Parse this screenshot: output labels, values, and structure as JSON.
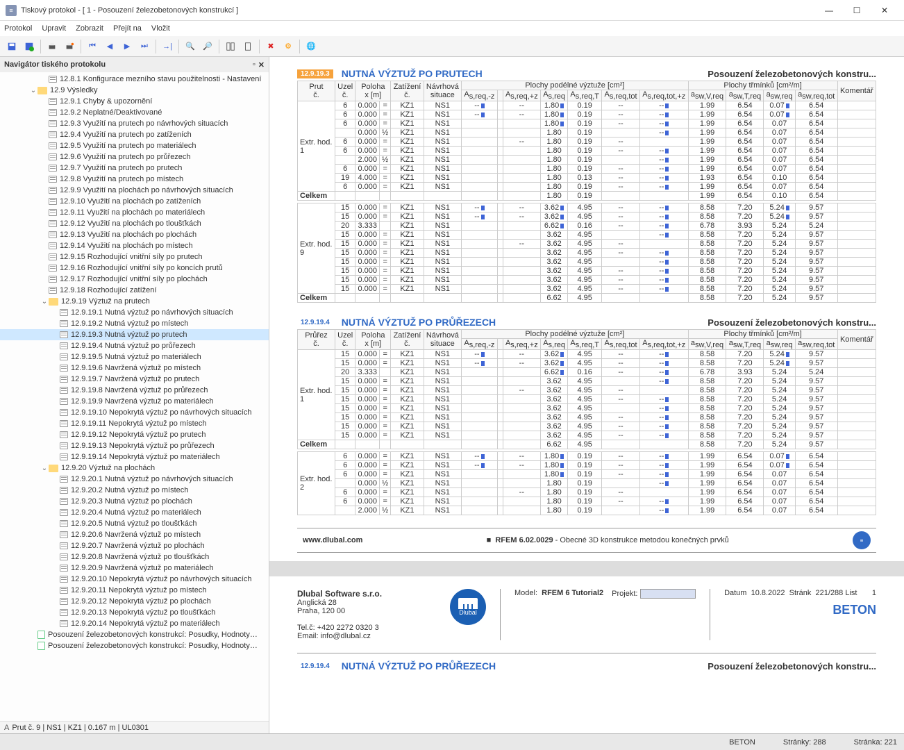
{
  "title": "Tiskový protokol - [ 1 - Posouzení železobetonových konstrukcí ]",
  "menu": [
    "Protokol",
    "Upravit",
    "Zobrazit",
    "Přejít na",
    "Vložit"
  ],
  "navHeader": "Navigátor tiského protokolu",
  "tree": [
    {
      "d": 3,
      "i": "grid",
      "t": "12.8.1 Konfigurace mezního stavu použitelnosti - Nastavení"
    },
    {
      "d": 2,
      "i": "folder",
      "t": "12.9 Výsledky",
      "tw": "v"
    },
    {
      "d": 3,
      "i": "grid",
      "t": "12.9.1 Chyby & upozornění"
    },
    {
      "d": 3,
      "i": "grid",
      "t": "12.9.2 Neplatné/Deaktivované"
    },
    {
      "d": 3,
      "i": "grid",
      "t": "12.9.3 Využití na prutech po návrhových situacích"
    },
    {
      "d": 3,
      "i": "grid",
      "t": "12.9.4 Využití na prutech po zatíženích"
    },
    {
      "d": 3,
      "i": "grid",
      "t": "12.9.5 Využití na prutech po materiálech"
    },
    {
      "d": 3,
      "i": "grid",
      "t": "12.9.6 Využití na prutech po průřezech"
    },
    {
      "d": 3,
      "i": "grid",
      "t": "12.9.7 Využití na prutech po prutech"
    },
    {
      "d": 3,
      "i": "grid",
      "t": "12.9.8 Využití na prutech po místech"
    },
    {
      "d": 3,
      "i": "grid",
      "t": "12.9.9 Využití na plochách po návrhových situacích"
    },
    {
      "d": 3,
      "i": "grid",
      "t": "12.9.10 Využití na plochách po zatíženích"
    },
    {
      "d": 3,
      "i": "grid",
      "t": "12.9.11 Využití na plochách po materiálech"
    },
    {
      "d": 3,
      "i": "grid",
      "t": "12.9.12 Využití na plochách po tloušťkách"
    },
    {
      "d": 3,
      "i": "grid",
      "t": "12.9.13 Využití na plochách po plochách"
    },
    {
      "d": 3,
      "i": "grid",
      "t": "12.9.14 Využití na plochách po místech"
    },
    {
      "d": 3,
      "i": "grid",
      "t": "12.9.15 Rozhodující vnitřní síly po prutech"
    },
    {
      "d": 3,
      "i": "grid",
      "t": "12.9.16 Rozhodující vnitřní síly po koncích prutů"
    },
    {
      "d": 3,
      "i": "grid",
      "t": "12.9.17 Rozhodující vnitřní síly po plochách"
    },
    {
      "d": 3,
      "i": "grid",
      "t": "12.9.18 Rozhodující zatížení"
    },
    {
      "d": 3,
      "i": "folder",
      "t": "12.9.19 Výztuž na prutech",
      "tw": "v"
    },
    {
      "d": 4,
      "i": "grid",
      "t": "12.9.19.1 Nutná výztuž po návrhových situacích"
    },
    {
      "d": 4,
      "i": "grid",
      "t": "12.9.19.2 Nutná výztuž po místech"
    },
    {
      "d": 4,
      "i": "grid",
      "t": "12.9.19.3 Nutná výztuž po prutech",
      "sel": true
    },
    {
      "d": 4,
      "i": "grid",
      "t": "12.9.19.4 Nutná výztuž po průřezech"
    },
    {
      "d": 4,
      "i": "grid",
      "t": "12.9.19.5 Nutná výztuž po materiálech"
    },
    {
      "d": 4,
      "i": "grid",
      "t": "12.9.19.6 Navržená výztuž po místech"
    },
    {
      "d": 4,
      "i": "grid",
      "t": "12.9.19.7 Navržená výztuž po prutech"
    },
    {
      "d": 4,
      "i": "grid",
      "t": "12.9.19.8 Navržená výztuž po průřezech"
    },
    {
      "d": 4,
      "i": "grid",
      "t": "12.9.19.9 Navržená výztuž po materiálech"
    },
    {
      "d": 4,
      "i": "grid",
      "t": "12.9.19.10 Nepokrytá výztuž po návrhových situacích"
    },
    {
      "d": 4,
      "i": "grid",
      "t": "12.9.19.11 Nepokrytá výztuž po místech"
    },
    {
      "d": 4,
      "i": "grid",
      "t": "12.9.19.12 Nepokrytá výztuž po prutech"
    },
    {
      "d": 4,
      "i": "grid",
      "t": "12.9.19.13 Nepokrytá výztuž po průřezech"
    },
    {
      "d": 4,
      "i": "grid",
      "t": "12.9.19.14 Nepokrytá výztuž po materiálech"
    },
    {
      "d": 3,
      "i": "folder",
      "t": "12.9.20 Výztuž na plochách",
      "tw": "v"
    },
    {
      "d": 4,
      "i": "grid",
      "t": "12.9.20.1 Nutná výztuž po návrhových situacích"
    },
    {
      "d": 4,
      "i": "grid",
      "t": "12.9.20.2 Nutná výztuž po místech"
    },
    {
      "d": 4,
      "i": "grid",
      "t": "12.9.20.3 Nutná výztuž po plochách"
    },
    {
      "d": 4,
      "i": "grid",
      "t": "12.9.20.4 Nutná výztuž po materiálech"
    },
    {
      "d": 4,
      "i": "grid",
      "t": "12.9.20.5 Nutná výztuž po tloušťkách"
    },
    {
      "d": 4,
      "i": "grid",
      "t": "12.9.20.6 Navržená výztuž po místech"
    },
    {
      "d": 4,
      "i": "grid",
      "t": "12.9.20.7 Navržená výztuž po plochách"
    },
    {
      "d": 4,
      "i": "grid",
      "t": "12.9.20.8 Navržená výztuž po tloušťkách"
    },
    {
      "d": 4,
      "i": "grid",
      "t": "12.9.20.9 Navržená výztuž po materiálech"
    },
    {
      "d": 4,
      "i": "grid",
      "t": "12.9.20.10 Nepokrytá výztuž po návrhových situacích"
    },
    {
      "d": 4,
      "i": "grid",
      "t": "12.9.20.11 Nepokrytá výztuž po místech"
    },
    {
      "d": 4,
      "i": "grid",
      "t": "12.9.20.12 Nepokrytá výztuž po plochách"
    },
    {
      "d": 4,
      "i": "grid",
      "t": "12.9.20.13 Nepokrytá výztuž po tloušťkách"
    },
    {
      "d": 4,
      "i": "grid",
      "t": "12.9.20.14 Nepokrytá výztuž po materiálech"
    },
    {
      "d": 2,
      "i": "doc",
      "t": "Posouzení železobetonových konstrukcí: Posudky, Hodnoty…"
    },
    {
      "d": 2,
      "i": "doc",
      "t": "Posouzení železobetonových konstrukcí: Posudky, Hodnoty…"
    }
  ],
  "statusLocal": "Prut č. 9 | NS1 | KZ1 | 0.167 m | UL0301",
  "sections": [
    {
      "tag": "12.9.19.3",
      "tagcls": "tag",
      "title": "NUTNÁ VÝZTUŽ PO PRUTECH",
      "right": "Posouzení železobetonových konstru...",
      "colA": "Prut",
      "exLabel": "Extr. hod.",
      "exNo": "1",
      "rows": [
        [
          "6",
          "0.000",
          "=",
          "KZ1",
          "NS1",
          "--",
          "",
          "--",
          "1.80",
          "0.19",
          "--",
          "--",
          "1.99",
          "6.54",
          "0.07",
          "6.54"
        ],
        [
          "6",
          "0.000",
          "=",
          "KZ1",
          "NS1",
          "--",
          "",
          "--",
          "1.80",
          "0.19",
          "--",
          "--",
          "1.99",
          "6.54",
          "0.07",
          "6.54"
        ],
        [
          "6",
          "0.000",
          "=",
          "KZ1",
          "NS1",
          "",
          "",
          "",
          "1.80",
          "0.19",
          "--",
          "--",
          "1.99",
          "6.54",
          "0.07",
          "6.54"
        ],
        [
          "",
          "0.000",
          "½",
          "KZ1",
          "NS1",
          "",
          "",
          "",
          "1.80",
          "0.19",
          "",
          "--",
          "1.99",
          "6.54",
          "0.07",
          "6.54"
        ],
        [
          "6",
          "0.000",
          "=",
          "KZ1",
          "NS1",
          "",
          "",
          "--",
          "1.80",
          "0.19",
          "--",
          "",
          "1.99",
          "6.54",
          "0.07",
          "6.54"
        ],
        [
          "6",
          "0.000",
          "=",
          "KZ1",
          "NS1",
          "",
          "",
          "",
          "1.80",
          "0.19",
          "--",
          "--",
          "1.99",
          "6.54",
          "0.07",
          "6.54"
        ],
        [
          "",
          "2.000",
          "½",
          "KZ1",
          "NS1",
          "",
          "",
          "",
          "1.80",
          "0.19",
          "",
          "--",
          "1.99",
          "6.54",
          "0.07",
          "6.54"
        ],
        [
          "6",
          "0.000",
          "=",
          "KZ1",
          "NS1",
          "",
          "",
          "",
          "1.80",
          "0.19",
          "--",
          "--",
          "1.99",
          "6.54",
          "0.07",
          "6.54"
        ],
        [
          "19",
          "4.000",
          "=",
          "KZ1",
          "NS1",
          "",
          "",
          "",
          "1.80",
          "0.13",
          "--",
          "--",
          "1.93",
          "6.54",
          "0.10",
          "6.54"
        ],
        [
          "6",
          "0.000",
          "=",
          "KZ1",
          "NS1",
          "",
          "",
          "",
          "1.80",
          "0.19",
          "--",
          "--",
          "1.99",
          "6.54",
          "0.07",
          "6.54"
        ]
      ],
      "total": [
        "Celkem",
        "",
        "",
        "",
        "",
        "",
        "",
        "",
        "1.80",
        "0.19",
        "",
        "",
        "1.99",
        "6.54",
        "0.10",
        "6.54"
      ],
      "ex2Label": "Extr. hod.",
      "ex2No": "9",
      "rows2": [
        [
          "15",
          "0.000",
          "=",
          "KZ1",
          "NS1",
          "--",
          "",
          "--",
          "3.62",
          "4.95",
          "--",
          "--",
          "8.58",
          "7.20",
          "5.24",
          "9.57"
        ],
        [
          "15",
          "0.000",
          "=",
          "KZ1",
          "NS1",
          "--",
          "",
          "--",
          "3.62",
          "4.95",
          "--",
          "--",
          "8.58",
          "7.20",
          "5.24",
          "9.57"
        ],
        [
          "20",
          "3.333",
          "",
          "KZ1",
          "NS1",
          "",
          "",
          "",
          "6.62",
          "0.16",
          "--",
          "--",
          "6.78",
          "3.93",
          "5.24",
          "5.24"
        ],
        [
          "15",
          "0.000",
          "=",
          "KZ1",
          "NS1",
          "",
          "",
          "",
          "3.62",
          "4.95",
          "",
          "--",
          "8.58",
          "7.20",
          "5.24",
          "9.57"
        ],
        [
          "15",
          "0.000",
          "=",
          "KZ1",
          "NS1",
          "",
          "",
          "--",
          "3.62",
          "4.95",
          "--",
          "",
          "8.58",
          "7.20",
          "5.24",
          "9.57"
        ],
        [
          "15",
          "0.000",
          "=",
          "KZ1",
          "NS1",
          "",
          "",
          "",
          "3.62",
          "4.95",
          "--",
          "--",
          "8.58",
          "7.20",
          "5.24",
          "9.57"
        ],
        [
          "15",
          "0.000",
          "=",
          "KZ1",
          "NS1",
          "",
          "",
          "",
          "3.62",
          "4.95",
          "",
          "--",
          "8.58",
          "7.20",
          "5.24",
          "9.57"
        ],
        [
          "15",
          "0.000",
          "=",
          "KZ1",
          "NS1",
          "",
          "",
          "",
          "3.62",
          "4.95",
          "--",
          "--",
          "8.58",
          "7.20",
          "5.24",
          "9.57"
        ],
        [
          "15",
          "0.000",
          "=",
          "KZ1",
          "NS1",
          "",
          "",
          "",
          "3.62",
          "4.95",
          "--",
          "--",
          "8.58",
          "7.20",
          "5.24",
          "9.57"
        ],
        [
          "15",
          "0.000",
          "=",
          "KZ1",
          "NS1",
          "",
          "",
          "",
          "3.62",
          "4.95",
          "--",
          "--",
          "8.58",
          "7.20",
          "5.24",
          "9.57"
        ]
      ],
      "total2": [
        "Celkem",
        "",
        "",
        "",
        "",
        "",
        "",
        "",
        "6.62",
        "4.95",
        "",
        "",
        "8.58",
        "7.20",
        "5.24",
        "9.57"
      ]
    },
    {
      "tag": "12.9.19.4",
      "tagcls": "tagb",
      "title": "NUTNÁ VÝZTUŽ PO PRŮŘEZECH",
      "right": "Posouzení železobetonových konstru...",
      "colA": "Průřez",
      "exLabel": "Extr. hod.",
      "exNo": "1",
      "rows": [
        [
          "15",
          "0.000",
          "=",
          "KZ1",
          "NS1",
          "--",
          "",
          "--",
          "3.62",
          "4.95",
          "--",
          "--",
          "8.58",
          "7.20",
          "5.24",
          "9.57"
        ],
        [
          "15",
          "0.000",
          "=",
          "KZ1",
          "NS1",
          "--",
          "",
          "--",
          "3.62",
          "4.95",
          "--",
          "--",
          "8.58",
          "7.20",
          "5.24",
          "9.57"
        ],
        [
          "20",
          "3.333",
          "",
          "KZ1",
          "NS1",
          "",
          "",
          "",
          "6.62",
          "0.16",
          "--",
          "--",
          "6.78",
          "3.93",
          "5.24",
          "5.24"
        ],
        [
          "15",
          "0.000",
          "=",
          "KZ1",
          "NS1",
          "",
          "",
          "",
          "3.62",
          "4.95",
          "",
          "--",
          "8.58",
          "7.20",
          "5.24",
          "9.57"
        ],
        [
          "15",
          "0.000",
          "=",
          "KZ1",
          "NS1",
          "",
          "",
          "--",
          "3.62",
          "4.95",
          "--",
          "",
          "8.58",
          "7.20",
          "5.24",
          "9.57"
        ],
        [
          "15",
          "0.000",
          "=",
          "KZ1",
          "NS1",
          "",
          "",
          "",
          "3.62",
          "4.95",
          "--",
          "--",
          "8.58",
          "7.20",
          "5.24",
          "9.57"
        ],
        [
          "15",
          "0.000",
          "=",
          "KZ1",
          "NS1",
          "",
          "",
          "",
          "3.62",
          "4.95",
          "",
          "--",
          "8.58",
          "7.20",
          "5.24",
          "9.57"
        ],
        [
          "15",
          "0.000",
          "=",
          "KZ1",
          "NS1",
          "",
          "",
          "",
          "3.62",
          "4.95",
          "--",
          "--",
          "8.58",
          "7.20",
          "5.24",
          "9.57"
        ],
        [
          "15",
          "0.000",
          "=",
          "KZ1",
          "NS1",
          "",
          "",
          "",
          "3.62",
          "4.95",
          "--",
          "--",
          "8.58",
          "7.20",
          "5.24",
          "9.57"
        ],
        [
          "15",
          "0.000",
          "=",
          "KZ1",
          "NS1",
          "",
          "",
          "",
          "3.62",
          "4.95",
          "--",
          "--",
          "8.58",
          "7.20",
          "5.24",
          "9.57"
        ]
      ],
      "total": [
        "Celkem",
        "",
        "",
        "",
        "",
        "",
        "",
        "",
        "6.62",
        "4.95",
        "",
        "",
        "8.58",
        "7.20",
        "5.24",
        "9.57"
      ],
      "ex2Label": "Extr. hod.",
      "ex2No": "2",
      "rows2": [
        [
          "6",
          "0.000",
          "=",
          "KZ1",
          "NS1",
          "--",
          "",
          "--",
          "1.80",
          "0.19",
          "--",
          "--",
          "1.99",
          "6.54",
          "0.07",
          "6.54"
        ],
        [
          "6",
          "0.000",
          "=",
          "KZ1",
          "NS1",
          "--",
          "",
          "--",
          "1.80",
          "0.19",
          "--",
          "--",
          "1.99",
          "6.54",
          "0.07",
          "6.54"
        ],
        [
          "6",
          "0.000",
          "=",
          "KZ1",
          "NS1",
          "",
          "",
          "",
          "1.80",
          "0.19",
          "--",
          "--",
          "1.99",
          "6.54",
          "0.07",
          "6.54"
        ],
        [
          "",
          "0.000",
          "½",
          "KZ1",
          "NS1",
          "",
          "",
          "",
          "1.80",
          "0.19",
          "",
          "--",
          "1.99",
          "6.54",
          "0.07",
          "6.54"
        ],
        [
          "6",
          "0.000",
          "=",
          "KZ1",
          "NS1",
          "",
          "",
          "--",
          "1.80",
          "0.19",
          "--",
          "",
          "1.99",
          "6.54",
          "0.07",
          "6.54"
        ],
        [
          "6",
          "0.000",
          "=",
          "KZ1",
          "NS1",
          "",
          "",
          "",
          "1.80",
          "0.19",
          "--",
          "--",
          "1.99",
          "6.54",
          "0.07",
          "6.54"
        ],
        [
          "",
          "2.000",
          "½",
          "KZ1",
          "NS1",
          "",
          "",
          "",
          "1.80",
          "0.19",
          "",
          "--",
          "1.99",
          "6.54",
          "0.07",
          "6.54"
        ]
      ]
    }
  ],
  "pageFooter": {
    "url": "www.dlubal.com",
    "app": "RFEM 6.02.0029",
    "desc": "Obecné 3D konstrukce metodou konečných prvků"
  },
  "company": {
    "name": "Dlubal Software s.r.o.",
    "l1": "Anglická 28",
    "l2": "Praha, 120 00",
    "tel": "Tel.č: +420 2272 0320 3",
    "mail": "Email: info@dlubal.cz"
  },
  "pmeta": {
    "model": "Model:",
    "modelv": "RFEM 6 Tutorial2",
    "proj": "Projekt:",
    "date": "Datum",
    "datev": "10.8.2022",
    "page": "Stránk",
    "pagev": "221/288",
    "list": "List",
    "listv": "1"
  },
  "beton": "BETON",
  "nextSec": {
    "tag": "12.9.19.4",
    "title": "NUTNÁ VÝZTUŽ PO PRŮŘEZECH",
    "right": "Posouzení železobetonových konstru..."
  },
  "hdr": {
    "h1": "Plochy podélné výztuže [cm²]",
    "h2": "Plochy třmínků [cm²/m]",
    "c": [
      "Uzel\nč.",
      "Poloha\nx [m]",
      "",
      "Zatížení\nč.",
      "Návrhová\nsituace",
      "Aₛ,req,-z",
      "",
      "Aₛ,req,+z",
      "Aₛ,req",
      "Aₛ,req,T",
      "Aₛ,req,tot",
      "Aₛ,req,tot,+z",
      "aₛw,V,req",
      "aₛw,T,req",
      "aₛw,req",
      "aₛw,req,tot",
      "Komentář"
    ]
  },
  "status": {
    "l": "BETON",
    "c": "Stránky: 288",
    "r": "Stránka: 221"
  }
}
